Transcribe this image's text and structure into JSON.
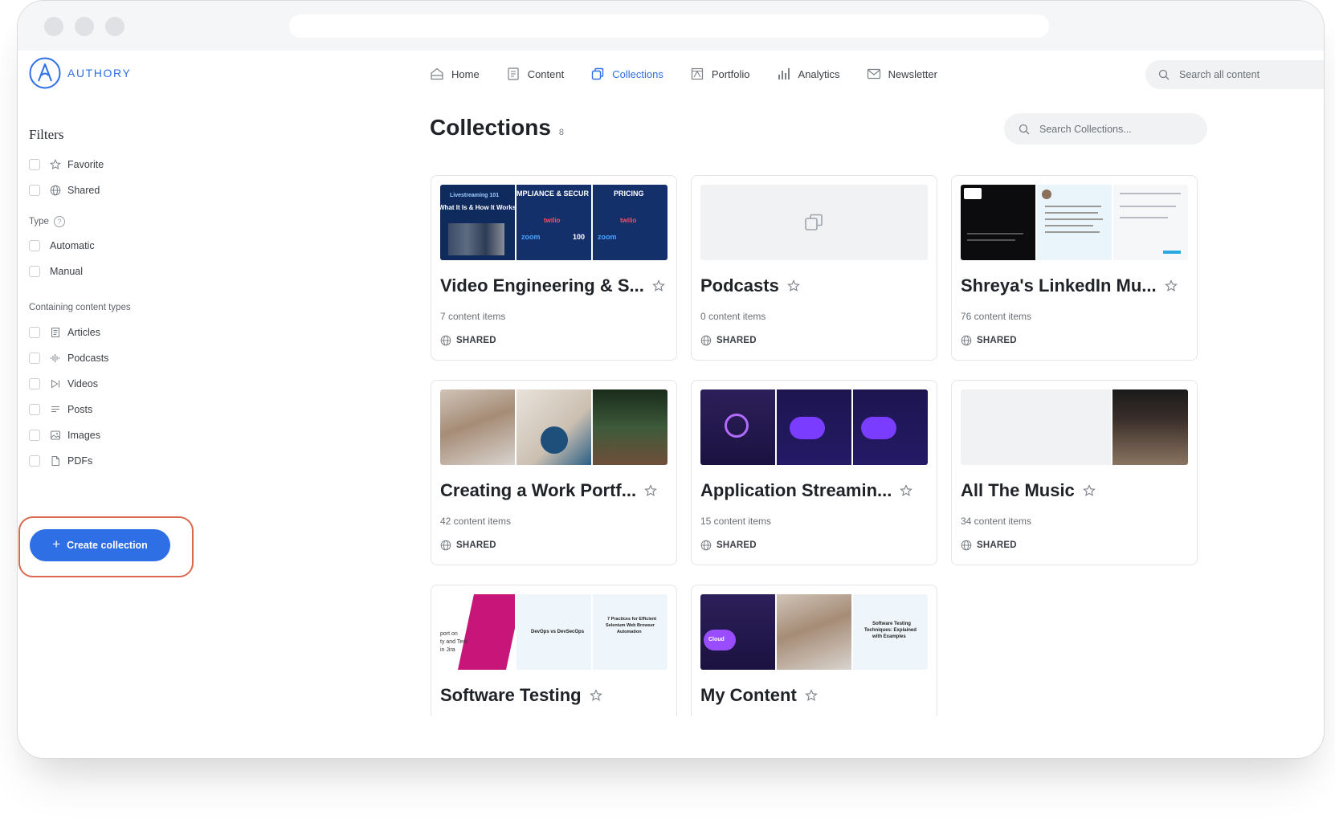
{
  "app": {
    "logo_text": "AUTHORY"
  },
  "nav": {
    "items": [
      {
        "label": "Home",
        "icon": "home-icon"
      },
      {
        "label": "Content",
        "icon": "content-icon"
      },
      {
        "label": "Collections",
        "icon": "collections-icon",
        "active": true
      },
      {
        "label": "Portfolio",
        "icon": "portfolio-icon"
      },
      {
        "label": "Analytics",
        "icon": "analytics-icon"
      },
      {
        "label": "Newsletter",
        "icon": "newsletter-icon"
      }
    ],
    "search_placeholder": "Search all content"
  },
  "sidebar": {
    "title": "Filters",
    "favorite": "Favorite",
    "shared": "Shared",
    "type_label": "Type",
    "type_help": "?",
    "automatic": "Automatic",
    "manual": "Manual",
    "content_types_label": "Containing content types",
    "content_types": [
      "Articles",
      "Podcasts",
      "Videos",
      "Posts",
      "Images",
      "PDFs"
    ],
    "create_button": "Create collection",
    "create_plus": "+"
  },
  "main": {
    "title": "Collections",
    "count": "8",
    "search_placeholder": "Search Collections...",
    "shared_label": "SHARED",
    "cards": [
      {
        "title": "Video Engineering & S...",
        "items": "7 content items",
        "shared": true
      },
      {
        "title": "Podcasts",
        "items": "0 content items",
        "shared": true
      },
      {
        "title": "Shreya's LinkedIn Mu...",
        "items": "76 content items",
        "shared": true
      },
      {
        "title": "Creating a Work Portf...",
        "items": "42 content items",
        "shared": true
      },
      {
        "title": "Application Streamin...",
        "items": "15 content items",
        "shared": true
      },
      {
        "title": "All The Music",
        "items": "34 content items",
        "shared": true
      },
      {
        "title": "Software Testing",
        "items": "",
        "shared": false
      },
      {
        "title": "My Content",
        "items": "",
        "shared": false
      }
    ],
    "thumb_text": {
      "v1": "Livestreaming 101",
      "v1b": "What It Is & How It Works",
      "v2": "MPLIANCE & SECUR",
      "v3": "PRICING",
      "twilio": "twilio",
      "zoom": "zoom",
      "hundred": "100",
      "s1": "port on",
      "s2": "ty and Test",
      "s3": "in Jira",
      "s4": "DevOps vs DevSecOps",
      "s5": "7 Practices for Efficient",
      "s6": "Selenium Web Browser",
      "s7": "Automation",
      "m1": "Software Testing",
      "m2": "Techniques: Explained",
      "m3": "with Examples",
      "cloud": "Cloud"
    }
  },
  "colors": {
    "accent": "#2e6fe6",
    "highlight": "#d9684f"
  }
}
